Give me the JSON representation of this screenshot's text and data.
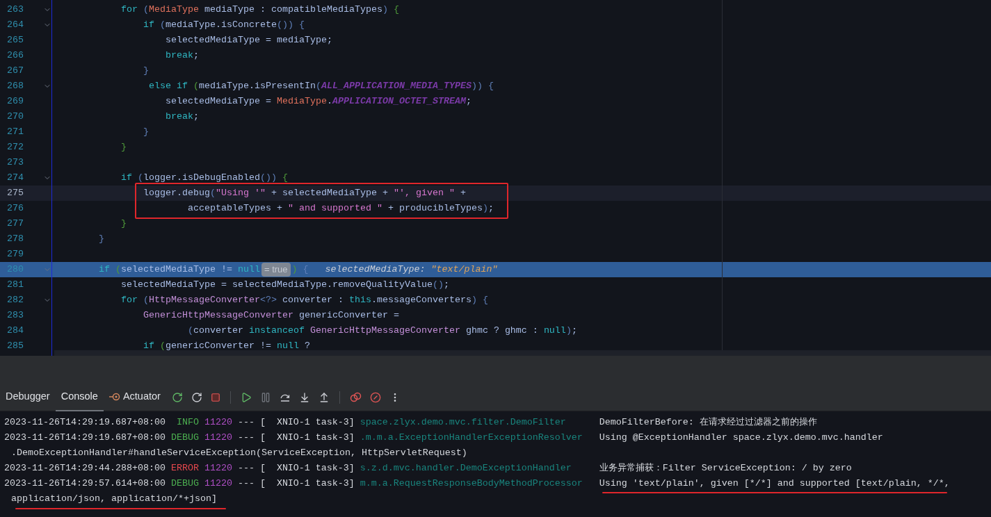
{
  "editor": {
    "lines": [
      {
        "number": "263",
        "fold": true,
        "selected": false,
        "execution_point": false,
        "tokens": [
          {
            "text": "            for",
            "kind": "kw"
          },
          {
            "text": " (",
            "kind": "punct"
          },
          {
            "text": "MediaType",
            "kind": "type"
          },
          {
            "text": " mediaType : compatibleMediaTypes",
            "kind": "ident"
          },
          {
            "text": ")",
            "kind": "punct"
          },
          {
            "text": " {",
            "kind": "brace"
          }
        ]
      },
      {
        "number": "264",
        "fold": true,
        "selected": false,
        "execution_point": false,
        "tokens": [
          {
            "text": "                if",
            "kind": "kw"
          },
          {
            "text": " (",
            "kind": "punct"
          },
          {
            "text": "mediaType.isConcrete",
            "kind": "ident"
          },
          {
            "text": "())",
            "kind": "punct"
          },
          {
            "text": " {",
            "kind": "punct"
          }
        ]
      },
      {
        "number": "265",
        "fold": false,
        "selected": false,
        "execution_point": false,
        "tokens": [
          {
            "text": "                    selectedMediaType = mediaType;",
            "kind": "ident"
          }
        ]
      },
      {
        "number": "266",
        "fold": false,
        "selected": false,
        "execution_point": false,
        "tokens": [
          {
            "text": "                    break",
            "kind": "kw"
          },
          {
            "text": ";",
            "kind": "ident"
          }
        ]
      },
      {
        "number": "267",
        "fold": false,
        "selected": false,
        "execution_point": false,
        "tokens": [
          {
            "text": "                }",
            "kind": "punct"
          }
        ]
      },
      {
        "number": "268",
        "fold": true,
        "selected": false,
        "execution_point": false,
        "tokens": [
          {
            "text": "                 else if",
            "kind": "kw"
          },
          {
            "text": " (",
            "kind": "brace"
          },
          {
            "text": "mediaType.isPresentIn",
            "kind": "ident"
          },
          {
            "text": "(",
            "kind": "punct"
          },
          {
            "text": "ALL_APPLICATION_MEDIA_TYPES",
            "kind": "const"
          },
          {
            "text": "))",
            "kind": "punct"
          },
          {
            "text": " {",
            "kind": "punct"
          }
        ]
      },
      {
        "number": "269",
        "fold": false,
        "selected": false,
        "execution_point": false,
        "tokens": [
          {
            "text": "                    selectedMediaType = ",
            "kind": "ident"
          },
          {
            "text": "MediaType",
            "kind": "type"
          },
          {
            "text": ".",
            "kind": "ident"
          },
          {
            "text": "APPLICATION_OCTET_STREAM",
            "kind": "const"
          },
          {
            "text": ";",
            "kind": "ident"
          }
        ]
      },
      {
        "number": "270",
        "fold": false,
        "selected": false,
        "execution_point": false,
        "tokens": [
          {
            "text": "                    break",
            "kind": "kw"
          },
          {
            "text": ";",
            "kind": "ident"
          }
        ]
      },
      {
        "number": "271",
        "fold": false,
        "selected": false,
        "execution_point": false,
        "tokens": [
          {
            "text": "                }",
            "kind": "punct"
          }
        ]
      },
      {
        "number": "272",
        "fold": false,
        "selected": false,
        "execution_point": false,
        "tokens": [
          {
            "text": "            }",
            "kind": "brace"
          }
        ]
      },
      {
        "number": "273",
        "fold": false,
        "selected": false,
        "execution_point": false
      },
      {
        "number": "274",
        "fold": true,
        "selected": false,
        "execution_point": false,
        "tokens": [
          {
            "text": "            if",
            "kind": "kw"
          },
          {
            "text": " (",
            "kind": "punct"
          },
          {
            "text": "logger.isDebugEnabled",
            "kind": "ident"
          },
          {
            "text": "())",
            "kind": "punct"
          },
          {
            "text": " {",
            "kind": "brace"
          }
        ]
      },
      {
        "number": "275",
        "fold": false,
        "selected": true,
        "execution_point": false,
        "tokens": [
          {
            "text": "                logger.debug",
            "kind": "ident"
          },
          {
            "text": "(",
            "kind": "punct"
          },
          {
            "text": "\"Using '\"",
            "kind": "str"
          },
          {
            "text": " + selectedMediaType + ",
            "kind": "ident"
          },
          {
            "text": "\"', given \"",
            "kind": "str"
          },
          {
            "text": " +",
            "kind": "ident"
          }
        ]
      },
      {
        "number": "276",
        "fold": false,
        "selected": false,
        "execution_point": false,
        "tokens": [
          {
            "text": "                        acceptableTypes + ",
            "kind": "ident"
          },
          {
            "text": "\" and supported \"",
            "kind": "str"
          },
          {
            "text": " + producibleTypes",
            "kind": "ident"
          },
          {
            "text": ")",
            "kind": "punct"
          },
          {
            "text": ";",
            "kind": "ident"
          }
        ]
      },
      {
        "number": "277",
        "fold": false,
        "selected": false,
        "execution_point": false,
        "tokens": [
          {
            "text": "            }",
            "kind": "brace"
          }
        ]
      },
      {
        "number": "278",
        "fold": false,
        "selected": false,
        "execution_point": false,
        "tokens": [
          {
            "text": "        }",
            "kind": "punct"
          }
        ]
      },
      {
        "number": "279",
        "fold": false,
        "selected": false,
        "execution_point": false
      },
      {
        "number": "280",
        "fold": true,
        "selected": false,
        "execution_point": true,
        "tokens": [
          {
            "text": "        if",
            "kind": "kw"
          },
          {
            "text": " (",
            "kind": "brace"
          },
          {
            "text": "selectedMediaType != ",
            "kind": "ident"
          },
          {
            "text": "null",
            "kind": "kw"
          },
          {
            "text": "= true",
            "kind": "badge"
          },
          {
            "text": ")",
            "kind": "brace"
          },
          {
            "text": " {",
            "kind": "punct"
          },
          {
            "text": "selectedMediaType: ",
            "kind": "hint_label"
          },
          {
            "text": "\"text/plain\"",
            "kind": "hint_value"
          }
        ]
      },
      {
        "number": "281",
        "fold": false,
        "selected": false,
        "execution_point": false,
        "tokens": [
          {
            "text": "            selectedMediaType = selectedMediaType.removeQualityValue",
            "kind": "ident"
          },
          {
            "text": "()",
            "kind": "punct"
          },
          {
            "text": ";",
            "kind": "ident"
          }
        ]
      },
      {
        "number": "282",
        "fold": true,
        "selected": false,
        "execution_point": false,
        "tokens": [
          {
            "text": "            for",
            "kind": "kw"
          },
          {
            "text": " (",
            "kind": "punct"
          },
          {
            "text": "HttpMessageConverter",
            "kind": "type2"
          },
          {
            "text": "<?>",
            "kind": "punct"
          },
          {
            "text": " converter : ",
            "kind": "ident"
          },
          {
            "text": "this",
            "kind": "kw"
          },
          {
            "text": ".messageConverters",
            "kind": "ident"
          },
          {
            "text": ")",
            "kind": "punct"
          },
          {
            "text": " {",
            "kind": "punct"
          }
        ]
      },
      {
        "number": "283",
        "fold": false,
        "selected": false,
        "execution_point": false,
        "tokens": [
          {
            "text": "                GenericHttpMessageConverter",
            "kind": "type2"
          },
          {
            "text": " genericConverter =",
            "kind": "ident"
          }
        ]
      },
      {
        "number": "284",
        "fold": false,
        "selected": false,
        "execution_point": false,
        "tokens": [
          {
            "text": "                        (",
            "kind": "punct"
          },
          {
            "text": "converter ",
            "kind": "ident"
          },
          {
            "text": "instanceof",
            "kind": "kw"
          },
          {
            "text": " GenericHttpMessageConverter",
            "kind": "type2"
          },
          {
            "text": " ghmc ? ghmc : ",
            "kind": "ident"
          },
          {
            "text": "null",
            "kind": "kw"
          },
          {
            "text": ")",
            "kind": "punct"
          },
          {
            "text": ";",
            "kind": "ident"
          }
        ]
      },
      {
        "number": "285",
        "fold": false,
        "selected": false,
        "execution_point": false,
        "tokens": [
          {
            "text": "                if",
            "kind": "kw"
          },
          {
            "text": " (",
            "kind": "brace"
          },
          {
            "text": "genericConverter != ",
            "kind": "ident"
          },
          {
            "text": "null",
            "kind": "kw"
          },
          {
            "text": " ?",
            "kind": "ident"
          }
        ]
      }
    ]
  },
  "tool_window": {
    "tabs": [
      {
        "label": "Debugger",
        "selected": false,
        "kind": "text"
      },
      {
        "label": "Console",
        "selected": true,
        "kind": "text"
      },
      {
        "label": "Actuator",
        "selected": false,
        "kind": "actuator"
      }
    ]
  },
  "console": {
    "lines": [
      {
        "kind": "entry",
        "timestamp": "2023-11-26T14:29:19.687+08:00",
        "severity": "INFO",
        "color": "#4caf50",
        "pid": "11220",
        "thread": "--- [  XNIO-1 task-3]",
        "logger": "space.zlyx.demo.mvc.filter.DemoFilter",
        "message": "DemoFilterBefore: 在请求经过过滤器之前的操作"
      },
      {
        "kind": "entry",
        "timestamp": "2023-11-26T14:29:19.687+08:00",
        "severity": "DEBUG",
        "color": "#4caf50",
        "pid": "11220",
        "thread": "--- [  XNIO-1 task-3]",
        "logger": ".m.m.a.ExceptionHandlerExceptionResolver",
        "message": "Using @ExceptionHandler space.zlyx.demo.mvc.handler"
      },
      {
        "kind": "continuation",
        "message": ".DemoExceptionHandler#handleServiceException(ServiceException, HttpServletRequest)"
      },
      {
        "kind": "entry",
        "timestamp": "2023-11-26T14:29:44.288+08:00",
        "severity": "ERROR",
        "color": "#e5484d",
        "pid": "11220",
        "thread": "--- [  XNIO-1 task-3]",
        "logger": "s.z.d.mvc.handler.DemoExceptionHandler",
        "message": "业务异常捕获：Filter ServiceException: / by zero"
      },
      {
        "kind": "entry",
        "timestamp": "2023-11-26T14:29:57.614+08:00",
        "severity": "DEBUG",
        "color": "#4caf50",
        "pid": "11220",
        "thread": "--- [  XNIO-1 task-3]",
        "logger": "m.m.a.RequestResponseBodyMethodProcessor",
        "message": "Using 'text/plain', given [*/*] and supported [text/plain, */*,"
      },
      {
        "kind": "continuation",
        "message": "application/json, application/*+json]"
      }
    ]
  }
}
